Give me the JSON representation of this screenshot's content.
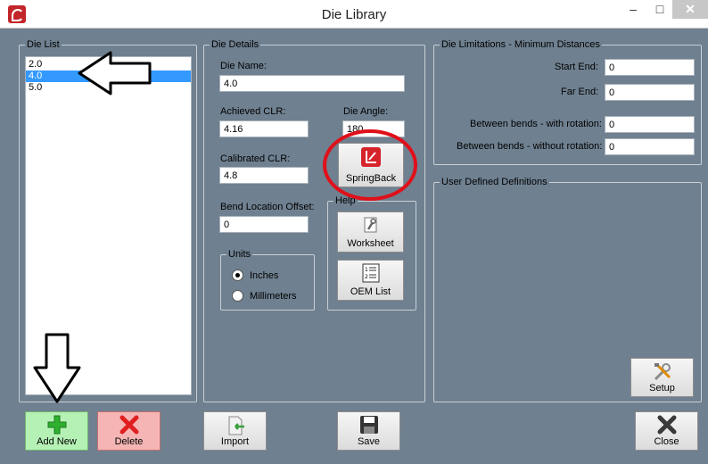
{
  "window": {
    "title": "Die Library",
    "min_glyph": "–",
    "max_glyph": "□",
    "close_glyph": "✕"
  },
  "die_list": {
    "group_title": "Die List",
    "items": [
      "2.0",
      "4.0",
      "5.0"
    ],
    "selected_index": 1
  },
  "die_details": {
    "group_title": "Die Details",
    "die_name_label": "Die Name:",
    "die_name_value": "4.0",
    "achieved_clr_label": "Achieved CLR:",
    "achieved_clr_value": "4.16",
    "die_angle_label": "Die Angle:",
    "die_angle_value": "180",
    "calibrated_clr_label": "Calibrated CLR:",
    "calibrated_clr_value": "4.8",
    "springback_label": "SpringBack",
    "bend_location_offset_label": "Bend Location Offset:",
    "bend_location_offset_value": "0",
    "units": {
      "group_title": "Units",
      "inches_label": "Inches",
      "millimeters_label": "Millimeters",
      "selected": "Inches"
    },
    "help": {
      "group_title": "Help",
      "worksheet_label": "Worksheet",
      "oem_list_label": "OEM List"
    }
  },
  "die_limitations": {
    "group_title": "Die Limitations - Minimum Distances",
    "start_end_label": "Start End:",
    "start_end_value": "0",
    "far_end_label": "Far End:",
    "far_end_value": "0",
    "with_rotation_label": "Between bends - with rotation:",
    "with_rotation_value": "0",
    "without_rotation_label": "Between bends - without rotation:",
    "without_rotation_value": "0"
  },
  "user_defined": {
    "group_title": "User Defined Definitions",
    "setup_label": "Setup"
  },
  "footer": {
    "add_new_label": "Add New",
    "delete_label": "Delete",
    "import_label": "Import",
    "save_label": "Save",
    "close_label": "Close"
  },
  "colors": {
    "background": "#6f8090",
    "add_new_bg": "#b5f0b5",
    "delete_bg": "#f5b5b5",
    "selection": "#3399ff",
    "annotation_red": "#e0101a"
  }
}
